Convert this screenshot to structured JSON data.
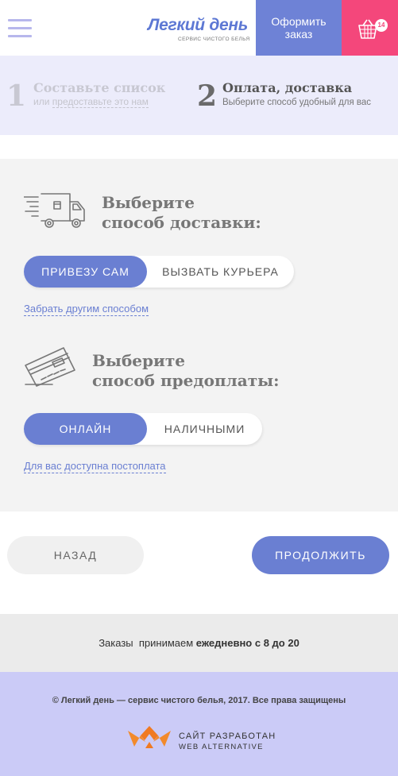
{
  "header": {
    "logo_title": "Легкий день",
    "logo_subtitle": "СЕРВИС ЧИСТОГО БЕЛЬЯ",
    "order_button": "Оформить заказ",
    "cart_count": "14",
    "colors": {
      "accent": "#6e82d6",
      "cart": "#f4477b",
      "burger": "#b7b7ec"
    },
    "icons": [
      "menu-icon",
      "basket-icon"
    ]
  },
  "steps": [
    {
      "number": "1",
      "title": "Составьте список",
      "sub_prefix": "или",
      "sub_link": "предоставьте это нам"
    },
    {
      "number": "2",
      "title": "Оплата, доставка",
      "sub": "Выберите способ удобный для вас"
    }
  ],
  "delivery": {
    "title_line1": "Выберите",
    "title_line2": "способ доставки:",
    "icon": "delivery-truck-icon",
    "options": [
      "ПРИВЕЗУ САМ",
      "ВЫЗВАТЬ КУРЬЕРА"
    ],
    "selected": "ПРИВЕЗУ САМ",
    "link": "Забрать другим способом"
  },
  "payment": {
    "title_line1": "Выберите",
    "title_line2": "способ предоплаты:",
    "icon": "credit-card-icon",
    "options": [
      "ОНЛАЙН",
      "НАЛИЧНЫМИ"
    ],
    "selected": "ОНЛАЙН",
    "link": "Для вас доступна постоплата"
  },
  "nav": {
    "back": "НАЗАД",
    "next": "ПРОДОЛЖИТЬ"
  },
  "hours": {
    "prefix": "Заказы  принимаем",
    "bold": "ежедневно с 8 до 20"
  },
  "footer": {
    "copyright": "© Легкий день — сервис чистого белья, 2017. Все права защищены",
    "dev_line1": "САЙТ РАЗРАБОТАН",
    "dev_line2": "WEB ALTERNATIVE",
    "dev_logo_icon": "web-alternative-logo-icon"
  }
}
